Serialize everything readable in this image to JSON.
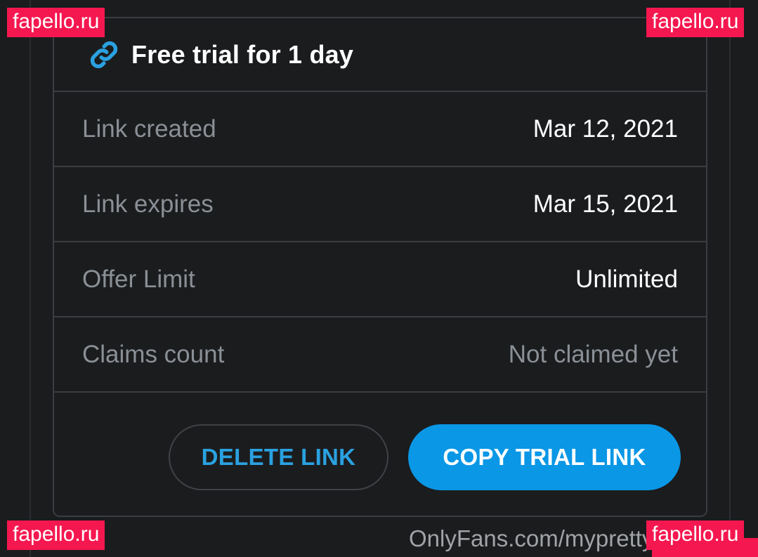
{
  "card": {
    "title": "Free trial for 1 day",
    "rows": [
      {
        "label": "Link created",
        "value": "Mar 12, 2021"
      },
      {
        "label": "Link expires",
        "value": "Mar 15, 2021"
      },
      {
        "label": "Offer Limit",
        "value": "Unlimited"
      },
      {
        "label": "Claims count",
        "value": "Not claimed yet"
      }
    ],
    "delete_label": "DELETE LINK",
    "copy_label": "COPY TRIAL LINK"
  },
  "watermarks": {
    "top_left": "fapello.ru",
    "top_right": "fapello.ru",
    "bottom_left": "fapello.ru",
    "bottom_right": "fapello.ru"
  },
  "footer": {
    "source_text": "OnlyFans.com/mypretty"
  },
  "colors": {
    "background": "#1b1c1e",
    "accent": "#0a97e6",
    "link_text": "#2aa1e0",
    "watermark": "#f5174f"
  },
  "icons": {
    "header_icon": "link-icon"
  }
}
